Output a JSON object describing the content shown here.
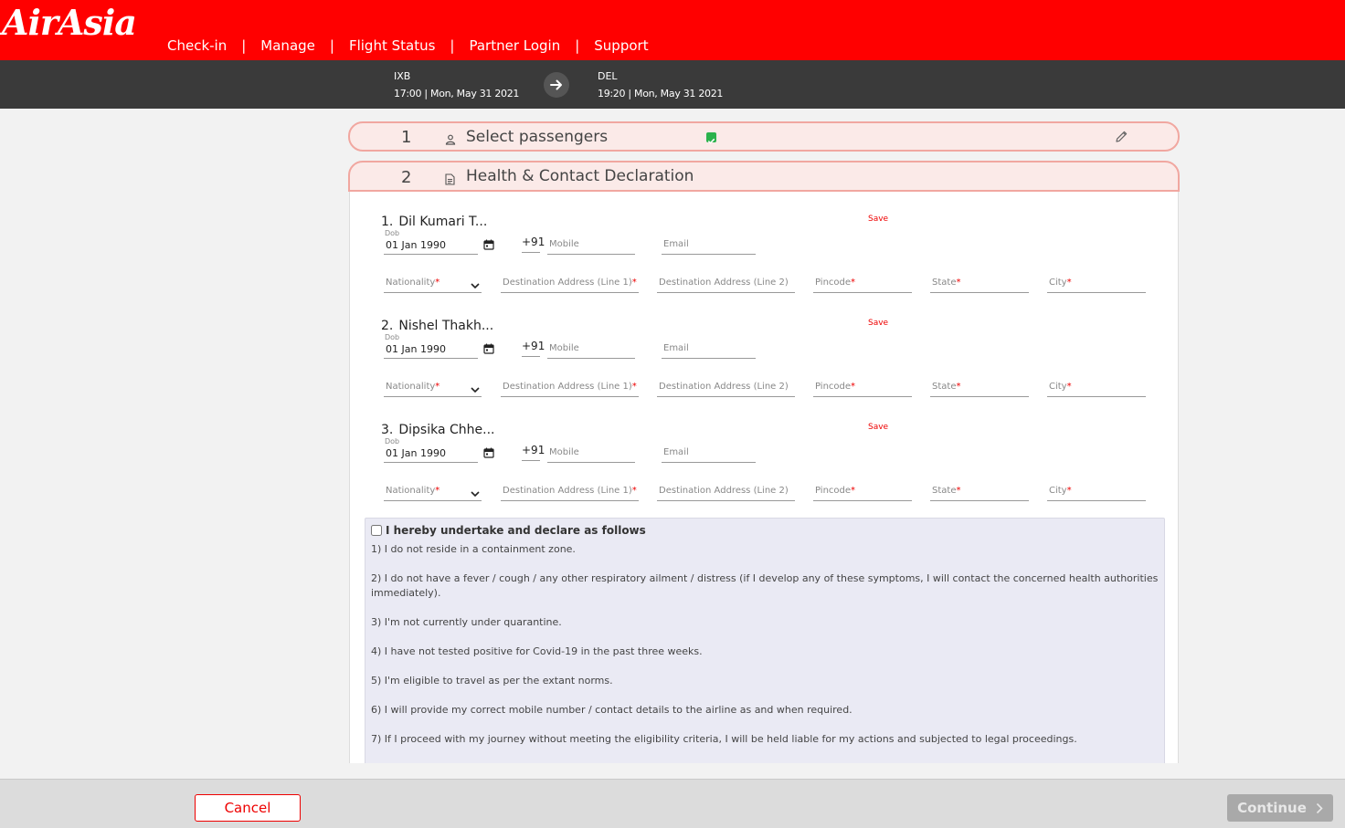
{
  "brand": {
    "logo_text": "AirAsia"
  },
  "nav": {
    "items": [
      "Check-in",
      "Manage",
      "Flight Status",
      "Partner Login",
      "Support"
    ],
    "separator": "|"
  },
  "flight": {
    "origin": {
      "code": "IXB",
      "time": "17:00 | Mon, May 31 2021"
    },
    "destination": {
      "code": "DEL",
      "time": "19:20 | Mon, May 31 2021"
    }
  },
  "steps": [
    {
      "number": "1",
      "title": "Select passengers",
      "icon": "person-icon",
      "completed": true
    },
    {
      "number": "2",
      "title": "Health & Contact Declaration",
      "icon": "document-icon"
    }
  ],
  "form": {
    "save_label": "Save",
    "dob_label": "Dob",
    "country_code": "+91",
    "placeholders": {
      "mobile": "Mobile",
      "email": "Email",
      "nationality": "Nationality",
      "address1": "Destination Address (Line 1)",
      "address2": "Destination Address (Line 2)",
      "pincode": "Pincode",
      "state": "State",
      "city": "City",
      "required_mark": "*"
    },
    "passengers": [
      {
        "index": "1.",
        "name": "Dil Kumari T...",
        "dob": "01 Jan 1990"
      },
      {
        "index": "2.",
        "name": "Nishel Thakh...",
        "dob": "01 Jan 1990"
      },
      {
        "index": "3.",
        "name": "Dipsika Chhe...",
        "dob": "01 Jan 1990"
      }
    ]
  },
  "declaration": {
    "heading": "I hereby undertake and declare as follows",
    "checked": false,
    "points": [
      "1) I do not reside in a containment zone.",
      "2) I do not have a fever / cough / any other respiratory ailment / distress (if I develop any of these symptoms, I will contact the concerned health authorities immediately).",
      "3) I'm not currently under quarantine.",
      "4) I have not tested positive for Covid-19 in the past three weeks.",
      "5) I'm eligible to travel as per the extant norms.",
      "6) I will provide my correct mobile number / contact details to the airline as and when required.",
      "7) If I proceed with my journey without meeting the eligibility criteria, I will be held liable for my actions and subjected to legal proceedings."
    ]
  },
  "footer": {
    "cancel_label": "Cancel",
    "continue_label": "Continue"
  },
  "colors": {
    "brand_red": "#ff0000",
    "dark_bar": "#3a3a3a",
    "step_bg": "#fbeae8",
    "step_border": "#f1a7a0",
    "check_green": "#2bb24c"
  }
}
